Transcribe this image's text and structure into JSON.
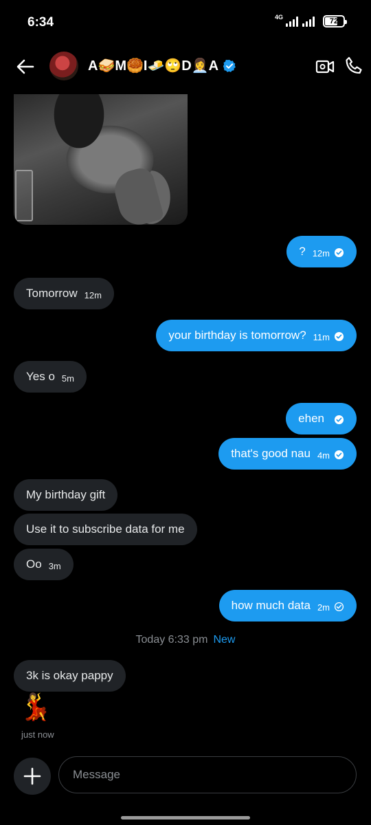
{
  "status_bar": {
    "time": "6:34",
    "network": "4G",
    "battery": "72",
    "battery_level_percent": 72
  },
  "header": {
    "contact_name": "A🥪M🥮I🧈🙄D👩‍💼A",
    "verified": true,
    "icons": [
      "back-arrow-icon",
      "video-icon",
      "phone-icon",
      "verified-badge-icon"
    ]
  },
  "colors": {
    "accent": "#1d9bf0",
    "incoming_bubble": "#202327",
    "background": "#000000"
  },
  "messages": [
    {
      "dir": "out",
      "text": "?",
      "time": "12m"
    },
    {
      "dir": "in",
      "text": "Tomorrow",
      "time": "12m"
    },
    {
      "dir": "out",
      "text": "your birthday is tomorrow?",
      "time": "11m"
    },
    {
      "dir": "in",
      "text": "Yes o",
      "time": "5m"
    },
    {
      "dir": "out",
      "text": "ehen",
      "time": ""
    },
    {
      "dir": "out",
      "text": "that's good nau",
      "time": "4m"
    },
    {
      "dir": "in",
      "text": "My birthday gift",
      "time": ""
    },
    {
      "dir": "in",
      "text": "Use it to subscribe data for me",
      "time": ""
    },
    {
      "dir": "in",
      "text": "Oo",
      "time": "3m"
    },
    {
      "dir": "out",
      "text": "how much data",
      "time": "2m"
    },
    {
      "dir": "in",
      "text": "3k is okay pappy",
      "time": ""
    }
  ],
  "divider": {
    "text": "Today 6:33 pm",
    "badge": "New"
  },
  "last_message": {
    "emoji": "💃",
    "time": "just now"
  },
  "composer": {
    "placeholder": "Message"
  }
}
